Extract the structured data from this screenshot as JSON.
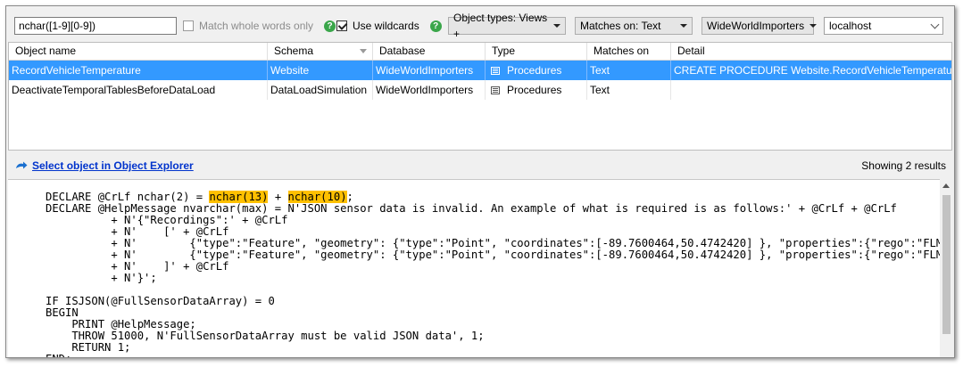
{
  "toolbar": {
    "search_value": "nchar([1-9][0-9])",
    "match_whole_words_label": "Match whole words only",
    "use_wildcards_label": "Use wildcards",
    "help_glyph": "?",
    "object_types_label": "Object types: Views +",
    "matches_on_label": "Matches on: Text",
    "database_value": "WideWorldImporters",
    "server_value": "localhost"
  },
  "grid": {
    "columns": [
      "Object name",
      "Schema",
      "Database",
      "Type",
      "Matches on",
      "Detail"
    ],
    "rows": [
      {
        "object_name": "RecordVehicleTemperature",
        "schema": "Website",
        "database": "WideWorldImporters",
        "type": "Procedures",
        "matches_on": "Text",
        "detail": "CREATE PROCEDURE Website.RecordVehicleTemperature  ...",
        "selected": true
      },
      {
        "object_name": "DeactivateTemporalTablesBeforeDataLoad",
        "schema": "DataLoadSimulation",
        "database": "WideWorldImporters",
        "type": "Procedures",
        "matches_on": "Text",
        "detail": "",
        "selected": false
      }
    ]
  },
  "linkbar": {
    "select_object_label": "Select object in Object Explorer",
    "results_label": "Showing 2 results"
  },
  "code": {
    "line1_prefix": "DECLARE @CrLf nchar(2) = ",
    "line1_match1": "nchar(13)",
    "line1_mid": " + ",
    "line1_match2": "nchar(10)",
    "line1_suffix": ";",
    "rest": "DECLARE @HelpMessage nvarchar(max) = N'JSON sensor data is invalid. An example of what is required is as follows:' + @CrLf + @CrLf\n          + N'{\"Recordings\":' + @CrLf\n          + N'    [' + @CrLf\n          + N'        {\"type\":\"Feature\", \"geometry\": {\"type\":\"Point\", \"coordinates\":[-89.7600464,50.4742420] }, \"properties\":{\"rego\":\"FLM-\n          + N'        {\"type\":\"Feature\", \"geometry\": {\"type\":\"Point\", \"coordinates\":[-89.7600464,50.4742420] }, \"properties\":{\"rego\":\"FLM-\n          + N'    ]' + @CrLf\n          + N'}';\n\nIF ISJSON(@FullSensorDataArray) = 0\nBEGIN\n    PRINT @HelpMessage;\n    THROW 51000, N'FullSensorDataArray must be valid JSON data', 1;\n    RETURN 1;\nEND;"
  },
  "colors": {
    "selection": "#3399ff",
    "highlight": "#ffc000",
    "link": "#0033cc",
    "help_icon": "#3aa64a"
  }
}
